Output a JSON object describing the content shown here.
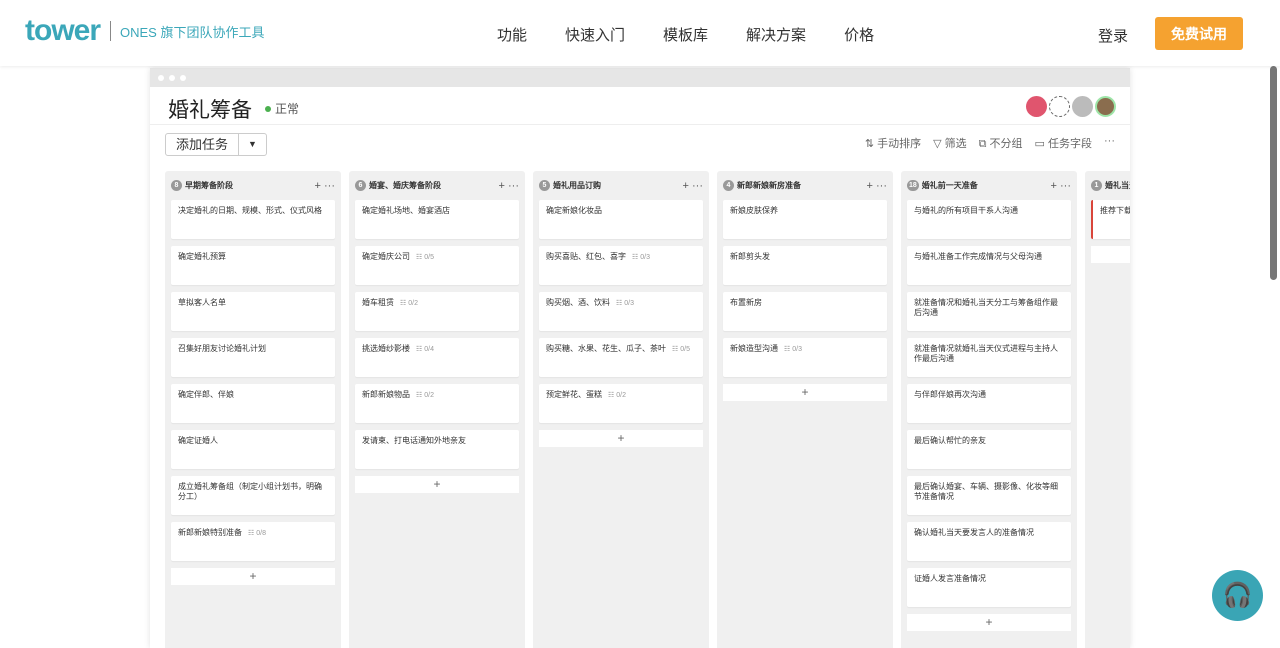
{
  "nav": {
    "logo": "tower",
    "tagline": "ONES 旗下团队协作工具",
    "menu": [
      "功能",
      "快速入门",
      "模板库",
      "解决方案",
      "价格"
    ],
    "login": "登录",
    "try": "免费试用"
  },
  "project": {
    "title": "婚礼筹备",
    "status": "正常",
    "add_task": "添加任务",
    "tools": [
      "手动排序",
      "筛选",
      "不分组",
      "任务字段"
    ]
  },
  "columns": [
    {
      "count": "8",
      "title": "早期筹备阶段",
      "cards": [
        {
          "t": "决定婚礼的日期、规模、形式、仪式风格"
        },
        {
          "t": "确定婚礼预算"
        },
        {
          "t": "草拟客人名单"
        },
        {
          "t": "召集好朋友讨论婚礼计划"
        },
        {
          "t": "确定伴郎、伴娘"
        },
        {
          "t": "确定证婚人"
        },
        {
          "t": "成立婚礼筹备组（制定小组计划书，明确分工）"
        },
        {
          "t": "新郎新娘特别准备",
          "s": "0/8"
        }
      ]
    },
    {
      "count": "6",
      "title": "婚宴、婚庆筹备阶段",
      "cards": [
        {
          "t": "确定婚礼场地、婚宴酒店"
        },
        {
          "t": "确定婚庆公司",
          "s": "0/5"
        },
        {
          "t": "婚车租赁",
          "s": "0/2"
        },
        {
          "t": "挑选婚纱影楼",
          "s": "0/4"
        },
        {
          "t": "新郎新娘物品",
          "s": "0/2"
        },
        {
          "t": "发请柬、打电话通知外地亲友"
        }
      ]
    },
    {
      "count": "5",
      "title": "婚礼用品订购",
      "cards": [
        {
          "t": "确定新娘化妆品"
        },
        {
          "t": "购买喜贴、红包、喜字",
          "s": "0/3"
        },
        {
          "t": "购买烟、酒、饮料",
          "s": "0/3"
        },
        {
          "t": "购买糖、水果、花生、瓜子、茶叶",
          "s": "0/5"
        },
        {
          "t": "预定鲜花、蛋糕",
          "s": "0/2"
        }
      ]
    },
    {
      "count": "4",
      "title": "新郎新娘新房准备",
      "cards": [
        {
          "t": "新娘皮肤保养"
        },
        {
          "t": "新郎剪头发"
        },
        {
          "t": "布置新房"
        },
        {
          "t": "新娘造型沟通",
          "s": "0/3"
        }
      ]
    },
    {
      "count": "18",
      "title": "婚礼前一天准备",
      "cards": [
        {
          "t": "与婚礼的所有项目干系人沟通"
        },
        {
          "t": "与婚礼准备工作完成情况与父母沟通"
        },
        {
          "t": "就准备情况和婚礼当天分工与筹备组作最后沟通"
        },
        {
          "t": "就准备情况就婚礼当天仪式进程与主持人作最后沟通"
        },
        {
          "t": "与伴郎伴娘再次沟通"
        },
        {
          "t": "最后确认帮忙的亲友"
        },
        {
          "t": "最后确认婚宴、车辆、摄影像、化妆等细节准备情况"
        },
        {
          "t": "确认婚礼当天要发言人的准备情况"
        },
        {
          "t": "证婚人发言准备情况"
        }
      ]
    },
    {
      "count": "1",
      "title": "婚礼当天",
      "cards": [
        {
          "t": "推荐下载",
          "red": true
        }
      ]
    }
  ]
}
